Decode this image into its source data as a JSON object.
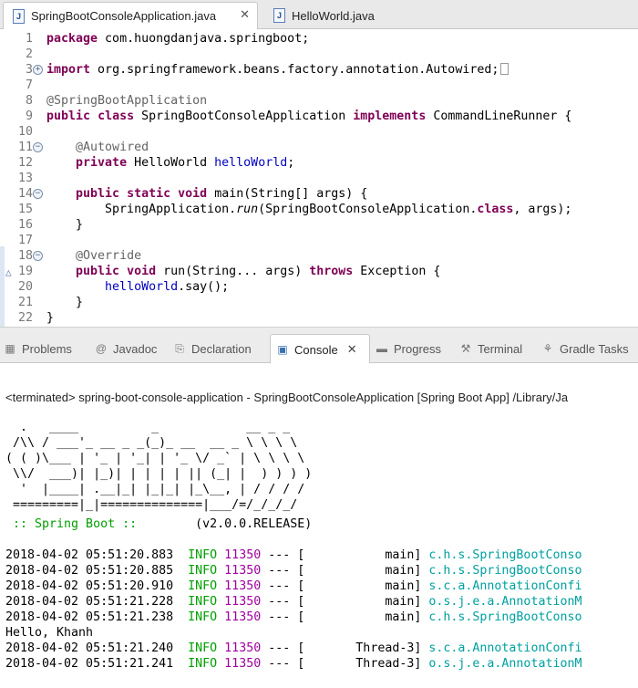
{
  "editor_tabs": [
    {
      "label": "SpringBootConsoleApplication.java",
      "active": true,
      "icon": "java-file-icon"
    },
    {
      "label": "HelloWorld.java",
      "active": false,
      "icon": "java-file-icon"
    }
  ],
  "code_lines": [
    {
      "n": "1",
      "html": "<span class=\"kw\">package</span> com.huongdanjava.springboot;"
    },
    {
      "n": "2",
      "html": ""
    },
    {
      "n": "3",
      "fold": "+",
      "html": "<span class=\"kw\">import</span> org.springframework.beans.factory.annotation.Autowired;<span class=\"dots\"></span>"
    },
    {
      "n": "7",
      "html": ""
    },
    {
      "n": "8",
      "html": "<span class=\"ann\">@SpringBootApplication</span>"
    },
    {
      "n": "9",
      "html": "<span class=\"kw\">public</span> <span class=\"kw\">class</span> SpringBootConsoleApplication <span class=\"kw\">implements</span> CommandLineRunner {"
    },
    {
      "n": "10",
      "html": ""
    },
    {
      "n": "11",
      "fold": "-",
      "html": "    <span class=\"ann\">@Autowired</span>"
    },
    {
      "n": "12",
      "html": "    <span class=\"kw\">private</span> HelloWorld <span class=\"fld\">helloWorld</span>;"
    },
    {
      "n": "13",
      "html": ""
    },
    {
      "n": "14",
      "fold": "-",
      "html": "    <span class=\"kw\">public</span> <span class=\"kw\">static</span> <span class=\"kw\">void</span> main(String[] args) {"
    },
    {
      "n": "15",
      "html": "        SpringApplication.<span class=\"itl\">run</span>(SpringBootConsoleApplication.<span class=\"kw\">class</span>, args);"
    },
    {
      "n": "16",
      "html": "    }"
    },
    {
      "n": "17",
      "html": ""
    },
    {
      "n": "18",
      "fold": "-",
      "html": "    <span class=\"ann\">@Override</span>"
    },
    {
      "n": "19",
      "override": true,
      "html": "    <span class=\"kw\">public</span> <span class=\"kw\">void</span> run(String... args) <span class=\"kw\">throws</span> Exception {"
    },
    {
      "n": "20",
      "html": "        <span class=\"fld\">helloWorld</span>.say();"
    },
    {
      "n": "21",
      "html": "    }"
    },
    {
      "n": "22",
      "html": "}"
    }
  ],
  "view_tabs": [
    {
      "label": "Problems",
      "icon": "problems-icon",
      "glyph": "▦"
    },
    {
      "label": "Javadoc",
      "icon": "javadoc-icon",
      "glyph": "@"
    },
    {
      "label": "Declaration",
      "icon": "declaration-icon",
      "glyph": "⎘"
    },
    {
      "label": "Console",
      "icon": "console-icon",
      "glyph": "▣",
      "active": true
    },
    {
      "label": "Progress",
      "icon": "progress-icon",
      "glyph": "▬"
    },
    {
      "label": "Terminal",
      "icon": "terminal-icon",
      "glyph": "⚒"
    },
    {
      "label": "Gradle Tasks",
      "icon": "gradle-icon",
      "glyph": "⚘"
    }
  ],
  "console": {
    "terminated": "<terminated> spring-boot-console-application - SpringBootConsoleApplication [Spring Boot App] /Library/Ja",
    "banner": [
      "  .   ____          _            __ _ _",
      " /\\\\ / ___'_ __ _ _(_)_ __  __ _ \\ \\ \\ \\",
      "( ( )\\___ | '_ | '_| | '_ \\/ _` | \\ \\ \\ \\",
      " \\\\/  ___)| |_)| | | | | || (_| |  ) ) ) )",
      "  '  |____| .__|_| |_|_| |_\\__, | / / / /",
      " =========|_|==============|___/=/_/_/_/"
    ],
    "boot_label": " :: Spring Boot :: ",
    "boot_version": "       (v2.0.0.RELEASE)",
    "logs": [
      {
        "ts": "2018-04-02 05:51:20.883",
        "level": "INFO",
        "pid": "11350",
        "sep": " --- [",
        "thread": "           main]",
        "logger": " c.h.s.SpringBootConso"
      },
      {
        "ts": "2018-04-02 05:51:20.885",
        "level": "INFO",
        "pid": "11350",
        "sep": " --- [",
        "thread": "           main]",
        "logger": " c.h.s.SpringBootConso"
      },
      {
        "ts": "2018-04-02 05:51:20.910",
        "level": "INFO",
        "pid": "11350",
        "sep": " --- [",
        "thread": "           main]",
        "logger": " s.c.a.AnnotationConfi"
      },
      {
        "ts": "2018-04-02 05:51:21.228",
        "level": "INFO",
        "pid": "11350",
        "sep": " --- [",
        "thread": "           main]",
        "logger": " o.s.j.e.a.AnnotationM"
      },
      {
        "ts": "2018-04-02 05:51:21.238",
        "level": "INFO",
        "pid": "11350",
        "sep": " --- [",
        "thread": "           main]",
        "logger": " c.h.s.SpringBootConso"
      },
      {
        "plain": "Hello, Khanh"
      },
      {
        "ts": "2018-04-02 05:51:21.240",
        "level": "INFO",
        "pid": "11350",
        "sep": " --- [",
        "thread": "       Thread-3]",
        "logger": " s.c.a.AnnotationConfi"
      },
      {
        "ts": "2018-04-02 05:51:21.241",
        "level": "INFO",
        "pid": "11350",
        "sep": " --- [",
        "thread": "       Thread-3]",
        "logger": " o.s.j.e.a.AnnotationM"
      }
    ]
  },
  "colors": {
    "keyword": "#7f0055",
    "annotation": "#646464",
    "field": "#0000c0",
    "info_green": "#00a000",
    "pid_purple": "#a000a0",
    "logger_teal": "#00a0a0"
  }
}
